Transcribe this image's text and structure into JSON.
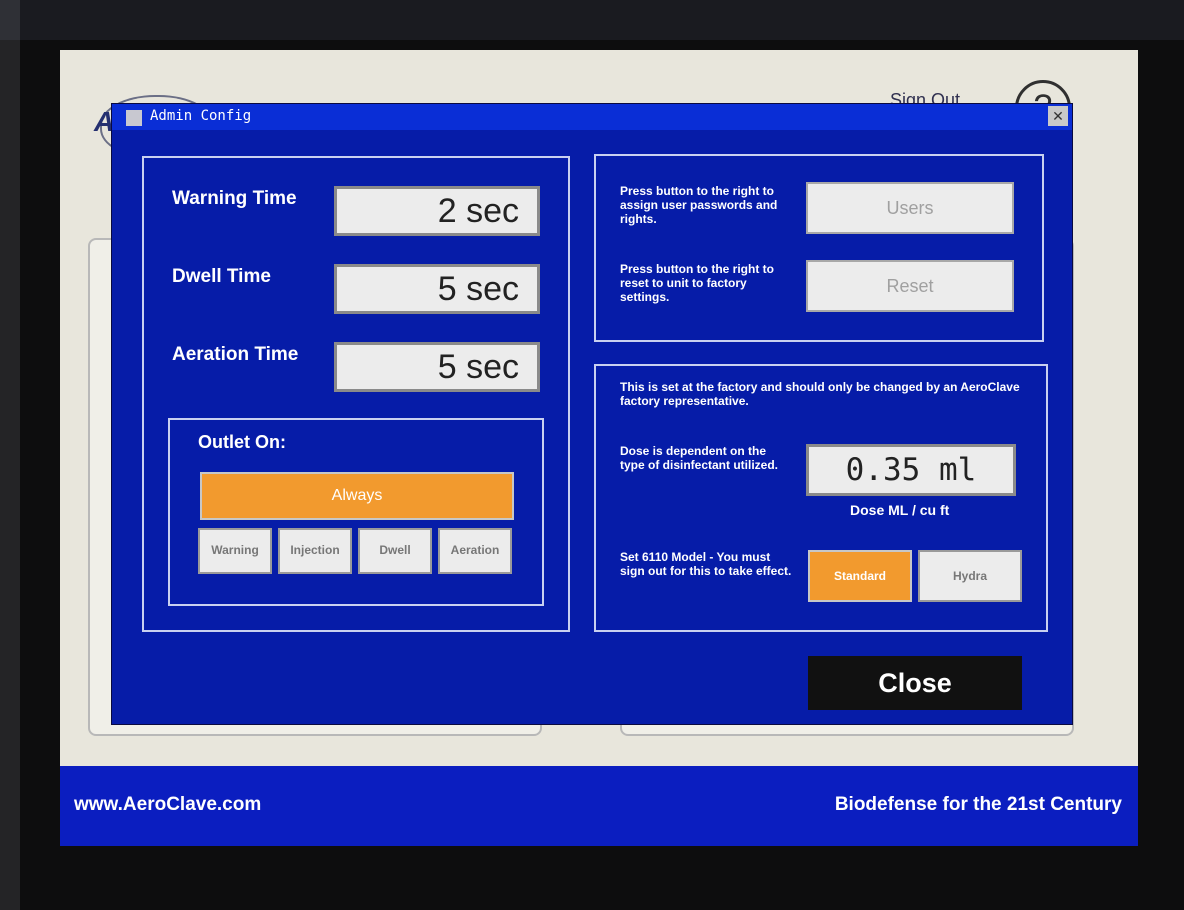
{
  "background": {
    "brand_partial": "A",
    "signout": "Sign Out",
    "help_label": "?"
  },
  "footer": {
    "url": "www.AeroClave.com",
    "slogan": "Biodefense for the 21st Century"
  },
  "dialog": {
    "title": "Admin Config",
    "close_label": "✕",
    "times": [
      {
        "label": "Warning Time",
        "value": "2 sec"
      },
      {
        "label": "Dwell Time",
        "value": "5 sec"
      },
      {
        "label": "Aeration Time",
        "value": "5 sec"
      }
    ],
    "outlet": {
      "heading": "Outlet On:",
      "always": "Always",
      "options": [
        "Warning",
        "Injection",
        "Dwell",
        "Aeration"
      ]
    },
    "users": {
      "text": "Press button to the right to assign user passwords and rights.",
      "button": "Users"
    },
    "reset": {
      "text": "Press button to the right to reset to unit to factory settings.",
      "button": "Reset"
    },
    "factory": {
      "note": "This is set at the factory and should only be changed by an AeroClave factory representative.",
      "dose_text": "Dose is dependent on the type of disinfectant utilized.",
      "dose_value": "0.35 ml",
      "dose_unit": "Dose ML / cu ft",
      "model_text": "Set 6110 Model - You must sign out for this to take effect.",
      "model_options": [
        "Standard",
        "Hydra"
      ],
      "model_selected": "Standard"
    },
    "close_button": "Close"
  },
  "colors": {
    "dialog_blue": "#061ca8",
    "title_blue": "#0a2ed6",
    "accent_orange": "#f29a2e",
    "footer_blue": "#0b1ec0"
  }
}
